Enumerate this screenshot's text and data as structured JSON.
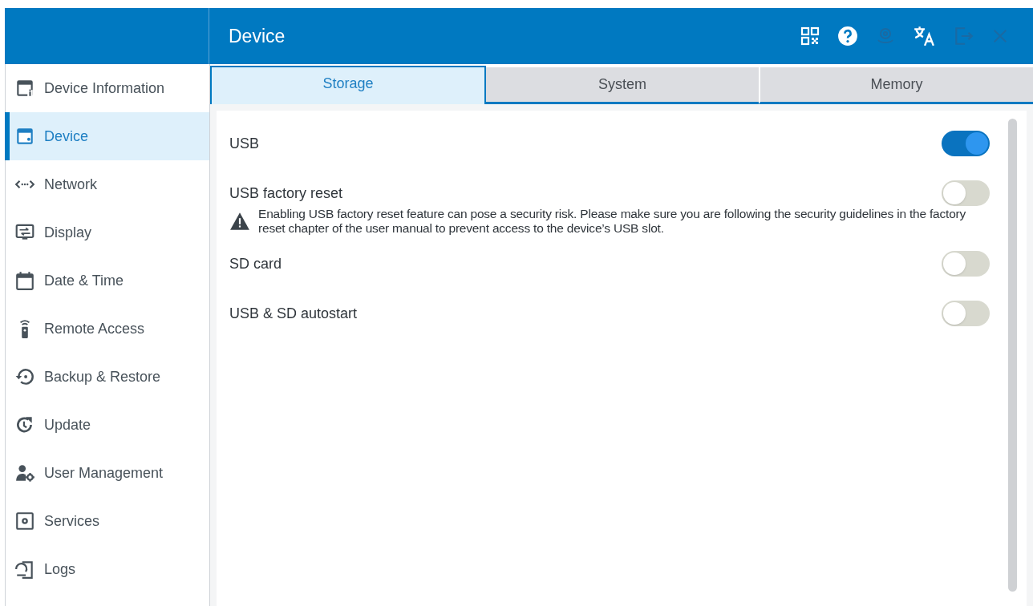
{
  "header": {
    "title": "Device",
    "actions": [
      {
        "disabled": false
      },
      {
        "disabled": false
      },
      {
        "disabled": true
      },
      {
        "disabled": false
      },
      {
        "disabled": true
      },
      {
        "disabled": true
      }
    ]
  },
  "sidebar": {
    "items": [
      {
        "label": "Device Information",
        "selected": false
      },
      {
        "label": "Device",
        "selected": true
      },
      {
        "label": "Network",
        "selected": false
      },
      {
        "label": "Display",
        "selected": false
      },
      {
        "label": "Date & Time",
        "selected": false
      },
      {
        "label": "Remote Access",
        "selected": false
      },
      {
        "label": "Backup & Restore",
        "selected": false
      },
      {
        "label": "Update",
        "selected": false
      },
      {
        "label": "User Management",
        "selected": false
      },
      {
        "label": "Services",
        "selected": false
      },
      {
        "label": "Logs",
        "selected": false
      }
    ]
  },
  "tabs": [
    {
      "label": "Storage",
      "selected": true
    },
    {
      "label": "System",
      "selected": false
    },
    {
      "label": "Memory",
      "selected": false
    }
  ],
  "settings": [
    {
      "kind": "toggle",
      "label": "USB",
      "on": true
    },
    {
      "kind": "toggle",
      "label": "USB factory reset",
      "on": false
    },
    {
      "kind": "warning",
      "text": "Enabling USB factory reset feature can pose a security risk. Please make sure you are following the security guidelines in the factory reset chapter of the user manual to prevent access to the device’s USB slot."
    },
    {
      "kind": "toggle",
      "label": "SD card",
      "on": false
    },
    {
      "kind": "toggle",
      "label": "USB & SD autostart",
      "on": false
    }
  ]
}
